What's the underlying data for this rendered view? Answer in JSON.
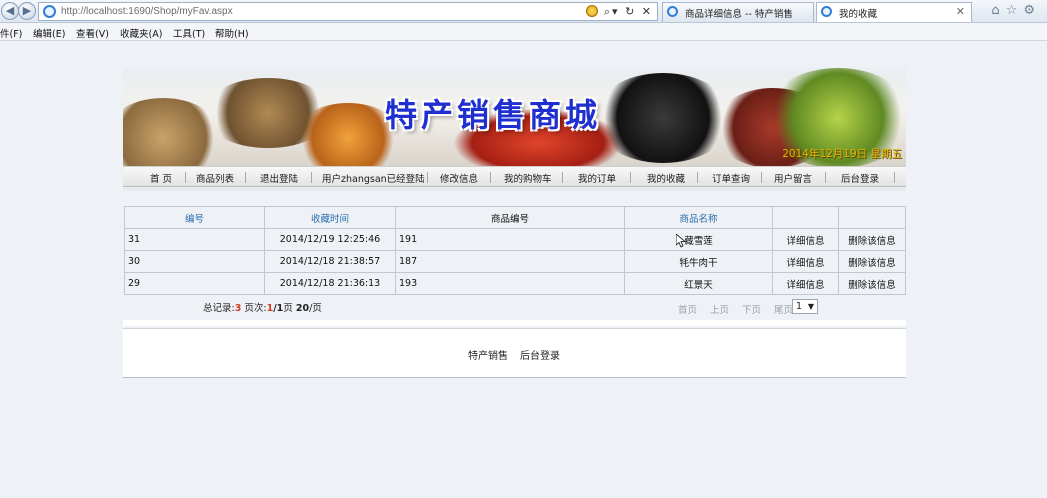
{
  "browser": {
    "url": "http://localhost:1690/Shop/myFav.aspx",
    "tabs": [
      {
        "label": "商品详细信息 -- 特产销售",
        "active": false
      },
      {
        "label": "我的收藏",
        "active": true
      }
    ]
  },
  "menu": [
    "件(F)",
    "编辑(E)",
    "查看(V)",
    "收藏夹(A)",
    "工具(T)",
    "帮助(H)"
  ],
  "banner": {
    "title": "特产销售商城",
    "date": "2014年12月19日 星期五"
  },
  "nav": [
    "首 页",
    "商品列表",
    "退出登陆",
    "用户zhangsan已经登陆",
    "修改信息",
    "我的购物车",
    "我的订单",
    "我的收藏",
    "订单查询",
    "用户留言",
    "后台登录"
  ],
  "table": {
    "headers": [
      "编号",
      "收藏时间",
      "商品编号",
      "商品名称",
      "",
      ""
    ],
    "rows": [
      {
        "id": "31",
        "time": "2014/12/19 12:25:46",
        "product_id": "191",
        "name": "藏雪莲",
        "detail": "详细信息",
        "delete": "删除该信息"
      },
      {
        "id": "30",
        "time": "2014/12/18 21:38:57",
        "product_id": "187",
        "name": "牦牛肉干",
        "detail": "详细信息",
        "delete": "删除该信息"
      },
      {
        "id": "29",
        "time": "2014/12/18 21:36:13",
        "product_id": "193",
        "name": "红景天",
        "detail": "详细信息",
        "delete": "删除该信息"
      }
    ]
  },
  "pager": {
    "total_label": "总记录:",
    "total": "3",
    "page_label": "页次:",
    "current": "1",
    "slash_total": "/1",
    "page_unit": "页",
    "per_page": "20",
    "per_page_unit": "/页",
    "first": "首页",
    "prev": "上页",
    "next": "下页",
    "last": "尾页",
    "selected_page": "1"
  },
  "footer": {
    "link1": "特产销售",
    "link2": "后台登录"
  }
}
